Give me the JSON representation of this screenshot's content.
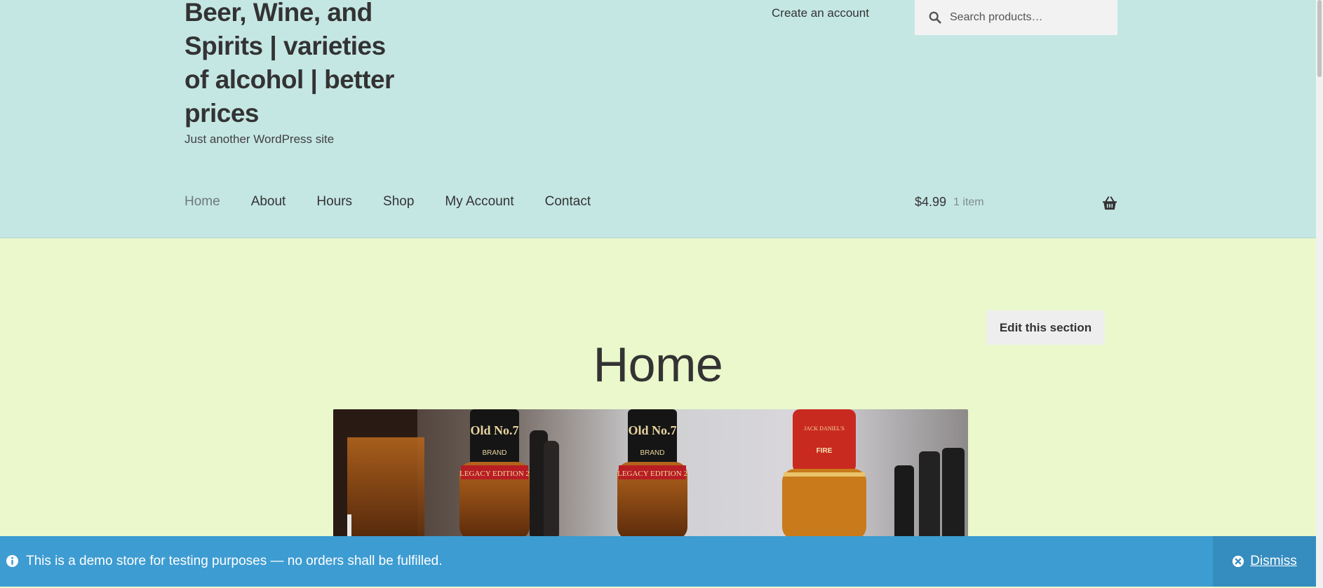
{
  "header": {
    "site_title": "Beer, Wine, and Spirits | varieties of alcohol | better prices",
    "tagline": "Just another WordPress site",
    "create_account": "Create an account",
    "search_placeholder": "Search products…",
    "background_color": "#c5e7e4"
  },
  "nav": {
    "items": [
      {
        "label": "Home",
        "current": true
      },
      {
        "label": "About"
      },
      {
        "label": "Hours"
      },
      {
        "label": "Shop"
      },
      {
        "label": "My Account"
      },
      {
        "label": "Contact"
      }
    ]
  },
  "cart": {
    "amount": "$4.99",
    "count": "1 item"
  },
  "main": {
    "edit_button": "Edit this section",
    "page_title": "Home",
    "background_color": "#eaf8cb",
    "hero_image": {
      "bottle_labels": [
        {
          "name": "Old No.7",
          "brand": "BRAND",
          "band": "LEGACY EDITION 2"
        },
        {
          "name": "Old No.7",
          "brand": "BRAND",
          "band": "LEGACY EDITION 2"
        },
        {
          "name": "JACK DANIEL'S",
          "band": "FIRE"
        }
      ]
    }
  },
  "notice": {
    "text": "This is a demo store for testing purposes — no orders shall be fulfilled.",
    "dismiss": "Dismiss",
    "background_color": "#3d9cd2"
  }
}
